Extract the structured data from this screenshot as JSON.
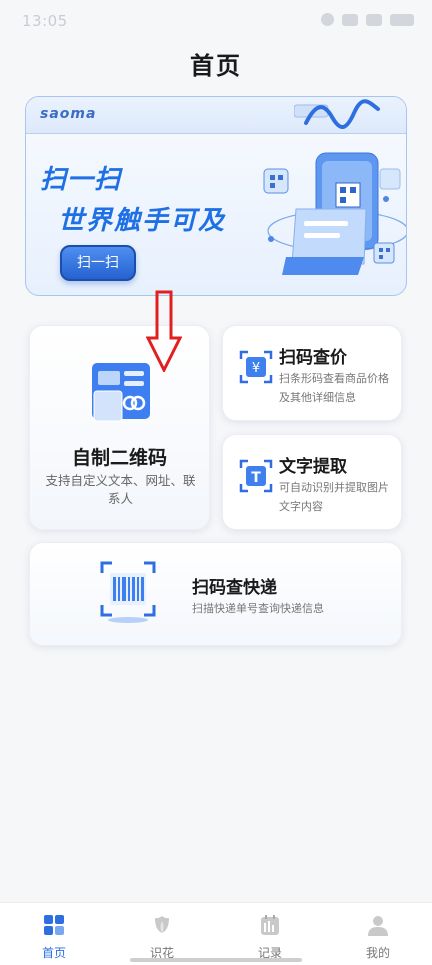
{
  "status_bar": {
    "time": "13:05"
  },
  "page": {
    "title": "首页"
  },
  "banner": {
    "brand": "saoma",
    "title_line1": "扫一扫",
    "title_line2": "世界触手可及",
    "button_label": "扫一扫"
  },
  "features": {
    "qr_generator": {
      "title": "自制二维码",
      "description": "支持自定义文本、网址、联系人"
    },
    "price_scan": {
      "title": "扫码查价",
      "description": "扫条形码查看商品价格及其他详细信息"
    },
    "text_extract": {
      "title": "文字提取",
      "description": "可自动识别并提取图片文字内容"
    },
    "express_scan": {
      "title": "扫码查快递",
      "description": "扫描快递单号查询快递信息"
    }
  },
  "tabbar": {
    "items": [
      {
        "label": "首页",
        "active": true
      },
      {
        "label": "识花",
        "active": false
      },
      {
        "label": "记录",
        "active": false
      },
      {
        "label": "我的",
        "active": false
      }
    ]
  },
  "colors": {
    "accent": "#2b6fe0",
    "banner_text": "#1f6fe5",
    "arrow": "#e02020"
  }
}
